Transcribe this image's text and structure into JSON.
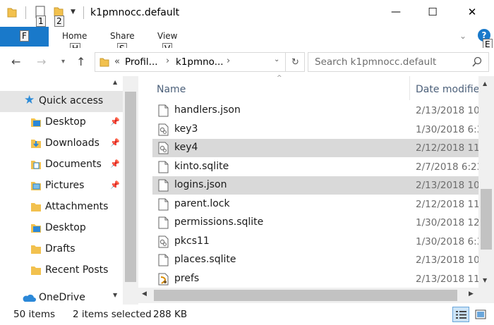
{
  "window": {
    "title": "k1pmnocc.default",
    "qat_keytip_1": "1",
    "qat_keytip_2": "2",
    "minimize": "—",
    "maximize": "☐",
    "close": "✕"
  },
  "ribbon": {
    "file_label": "F",
    "tabs": [
      {
        "label": "Home",
        "keytip": "H"
      },
      {
        "label": "Share",
        "keytip": "S"
      },
      {
        "label": "View",
        "keytip": "V"
      }
    ],
    "expand_keytip": "E"
  },
  "address": {
    "overflow": "«",
    "crumbs": [
      "Profil...",
      "k1pmno..."
    ],
    "search_placeholder": "Search k1pmnocc.default"
  },
  "nav": {
    "items": [
      {
        "label": "Quick access",
        "icon": "star-icon",
        "pinned": false
      },
      {
        "label": "Desktop",
        "icon": "desktop-folder-icon",
        "pinned": true
      },
      {
        "label": "Downloads",
        "icon": "downloads-folder-icon",
        "pinned": true
      },
      {
        "label": "Documents",
        "icon": "documents-folder-icon",
        "pinned": true
      },
      {
        "label": "Pictures",
        "icon": "pictures-folder-icon",
        "pinned": true
      },
      {
        "label": "Attachments",
        "icon": "folder-icon",
        "pinned": false
      },
      {
        "label": "Desktop",
        "icon": "desktop-folder-icon",
        "pinned": false
      },
      {
        "label": "Drafts",
        "icon": "folder-icon",
        "pinned": false
      },
      {
        "label": "Recent Posts",
        "icon": "folder-icon",
        "pinned": false
      },
      {
        "label": "OneDrive",
        "icon": "cloud-icon",
        "pinned": false
      }
    ]
  },
  "list": {
    "columns": [
      "Name",
      "Date modified"
    ],
    "rows": [
      {
        "name": "handlers.json",
        "date": "2/13/2018 10",
        "icon": "document-icon",
        "selected": false
      },
      {
        "name": "key3",
        "date": "1/30/2018 6:3",
        "icon": "system-file-icon",
        "selected": false
      },
      {
        "name": "key4",
        "date": "2/12/2018 11",
        "icon": "system-file-icon",
        "selected": true
      },
      {
        "name": "kinto.sqlite",
        "date": "2/7/2018 6:23",
        "icon": "document-icon",
        "selected": false
      },
      {
        "name": "logins.json",
        "date": "2/13/2018 10",
        "icon": "document-icon",
        "selected": true
      },
      {
        "name": "parent.lock",
        "date": "2/12/2018 11",
        "icon": "document-icon",
        "selected": false
      },
      {
        "name": "permissions.sqlite",
        "date": "1/30/2018 12",
        "icon": "document-icon",
        "selected": false
      },
      {
        "name": "pkcs11",
        "date": "1/30/2018 6:3",
        "icon": "system-file-icon",
        "selected": false
      },
      {
        "name": "places.sqlite",
        "date": "2/13/2018 10",
        "icon": "document-icon",
        "selected": false
      },
      {
        "name": "prefs",
        "date": "2/13/2018 11",
        "icon": "script-file-icon",
        "selected": false
      }
    ]
  },
  "status": {
    "count": "50 items",
    "selection": "2 items selected",
    "size": "288 KB"
  },
  "colors": {
    "accent": "#1979ca",
    "selected_row": "#d9d9d9",
    "header_text": "#4c607a",
    "folder_yellow": "#f2c14e"
  }
}
